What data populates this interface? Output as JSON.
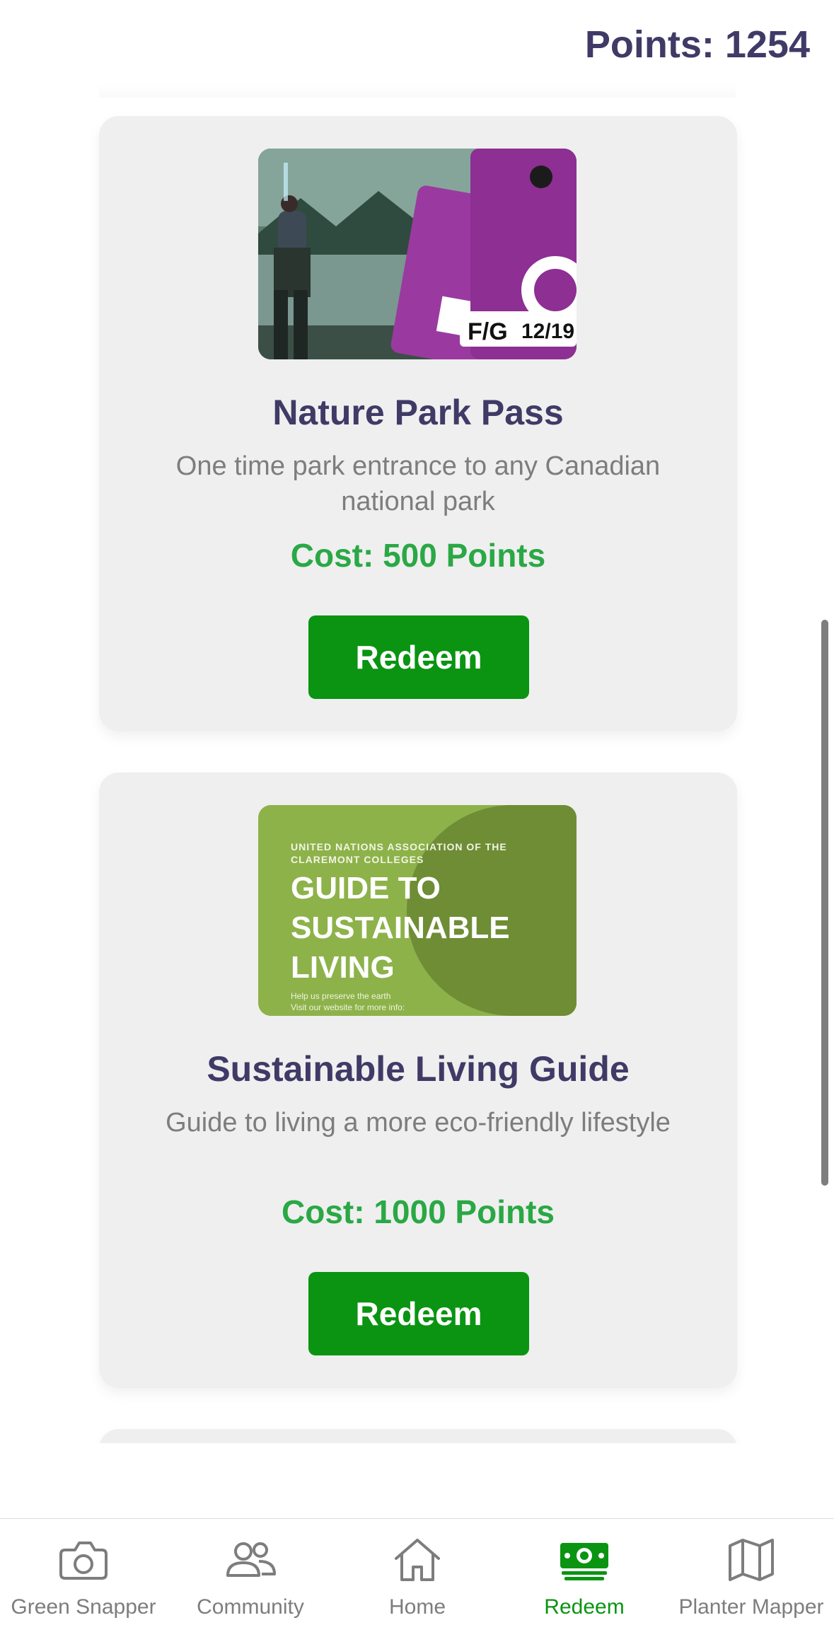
{
  "header": {
    "points_label": "Points: 1254"
  },
  "rewards": [
    {
      "title": "Nature Park Pass",
      "description": "One time park entrance to any Canadian national park",
      "cost": "Cost: 500 Points",
      "button": "Redeem",
      "image_text": {
        "tag_left": "F/G",
        "tag_right": "12/19"
      }
    },
    {
      "title": "Sustainable Living Guide",
      "description": "Guide to living a more eco-friendly lifestyle",
      "cost": "Cost: 1000 Points",
      "button": "Redeem",
      "image_text": {
        "small_line1": "UNITED NATIONS ASSOCIATION OF THE",
        "small_line2": "CLAREMONT COLLEGES",
        "big_line1": "GUIDE TO",
        "big_line2": "SUSTAINABLE",
        "big_line3": "LIVING",
        "foot_line1": "Help us preserve the earth",
        "foot_line2": "Visit our website for more info:"
      }
    }
  ],
  "tabs": [
    {
      "label": "Green Snapper",
      "icon": "camera-icon"
    },
    {
      "label": "Community",
      "icon": "people-icon"
    },
    {
      "label": "Home",
      "icon": "home-icon"
    },
    {
      "label": "Redeem",
      "icon": "cash-icon",
      "active": true
    },
    {
      "label": "Planter Mapper",
      "icon": "map-icon"
    }
  ],
  "colors": {
    "title": "#3f3a66",
    "cost": "#2aa845",
    "button": "#0a9412",
    "active_tab": "#0a9412",
    "inactive_tab": "#7d7d7d"
  }
}
